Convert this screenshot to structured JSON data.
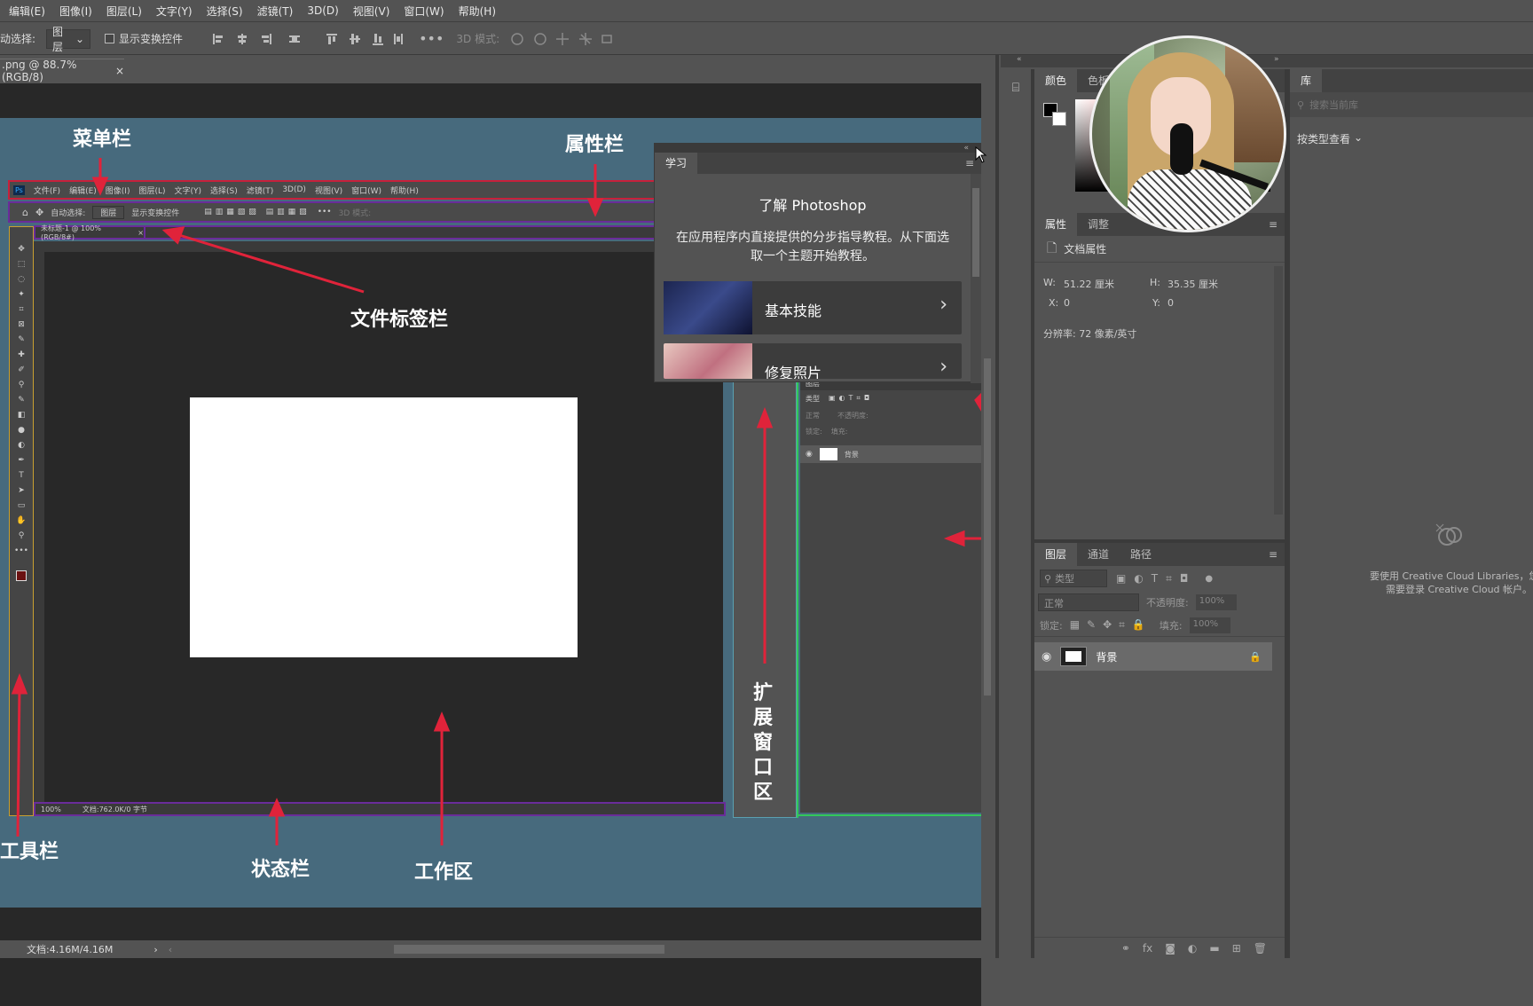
{
  "menubar": {
    "items": [
      "编辑(E)",
      "图像(I)",
      "图层(L)",
      "文字(Y)",
      "选择(S)",
      "滤镜(T)",
      "3D(D)",
      "视图(V)",
      "窗口(W)",
      "帮助(H)"
    ]
  },
  "optbar": {
    "auto_select_label": "动选择:",
    "auto_select_value": "图层",
    "show_transform_label": "显示变换控件",
    "mode_3d_label": "3D 模式:"
  },
  "doctab": {
    "title": ".png @ 88.7%(RGB/8)",
    "close": "×"
  },
  "annotations": {
    "menubar": "菜单栏",
    "optbar": "属性栏",
    "doctab": "文件标签栏",
    "toolbar": "工具栏",
    "statusbar": "状态栏",
    "workarea": "工作区",
    "expand": "扩展窗口区"
  },
  "mini_ps": {
    "menus": [
      "文件(F)",
      "编辑(E)",
      "图像(I)",
      "图层(L)",
      "文字(Y)",
      "选择(S)",
      "滤镜(T)",
      "3D(D)",
      "视图(V)",
      "窗口(W)",
      "帮助(H)"
    ],
    "auto_select": "自动选择:",
    "layer_sel": "图层",
    "show_transform": "显示变换控件",
    "mode3d": "3D 模式:",
    "tab_title": "未标题-1 @ 100%(RGB/8#)",
    "zoom": "100%",
    "doc_info": "文档:762.0K/0 字节",
    "layers_tab": "图层",
    "layer_bg": "背景",
    "kind": "类型",
    "normal": "正常",
    "opacity": "不透明度:",
    "lock": "锁定:",
    "fill": "填充:"
  },
  "learn_panel": {
    "tab": "学习",
    "heading": "了解 Photoshop",
    "desc": "在应用程序内直接提供的分步指导教程。从下面选取一个主题开始教程。",
    "cards": [
      "基本技能",
      "修复照片"
    ]
  },
  "status": {
    "doc": "文档:4.16M/4.16M"
  },
  "color_panel": {
    "tabs": [
      "颜色",
      "色板"
    ]
  },
  "props_panel": {
    "tabs": [
      "属性",
      "调整"
    ],
    "doc_props": "文档属性",
    "w_label": "W:",
    "w_value": "51.22 厘米",
    "h_label": "H:",
    "h_value": "35.35 厘米",
    "x_label": "X:",
    "x_value": "0",
    "y_label": "Y:",
    "y_value": "0",
    "resolution": "分辨率: 72 像素/英寸"
  },
  "layers_panel": {
    "tabs": [
      "图层",
      "通道",
      "路径"
    ],
    "kind": "类型",
    "blend": "正常",
    "opacity_label": "不透明度:",
    "opacity_value": "100%",
    "lock_label": "锁定:",
    "fill_label": "填充:",
    "fill_value": "100%",
    "layer_name": "背景"
  },
  "lib_panel": {
    "tab": "库",
    "search_placeholder": "搜索当前库",
    "view_by": "按类型查看",
    "msg1": "要使用 Creative Cloud Libraries，您",
    "msg2": "需要登录 Creative Cloud 帐户。"
  },
  "colors": {
    "arrow": "#e0233a",
    "canvas_bg": "#476a7d",
    "work_bg": "#282828",
    "panel": "#535353"
  }
}
